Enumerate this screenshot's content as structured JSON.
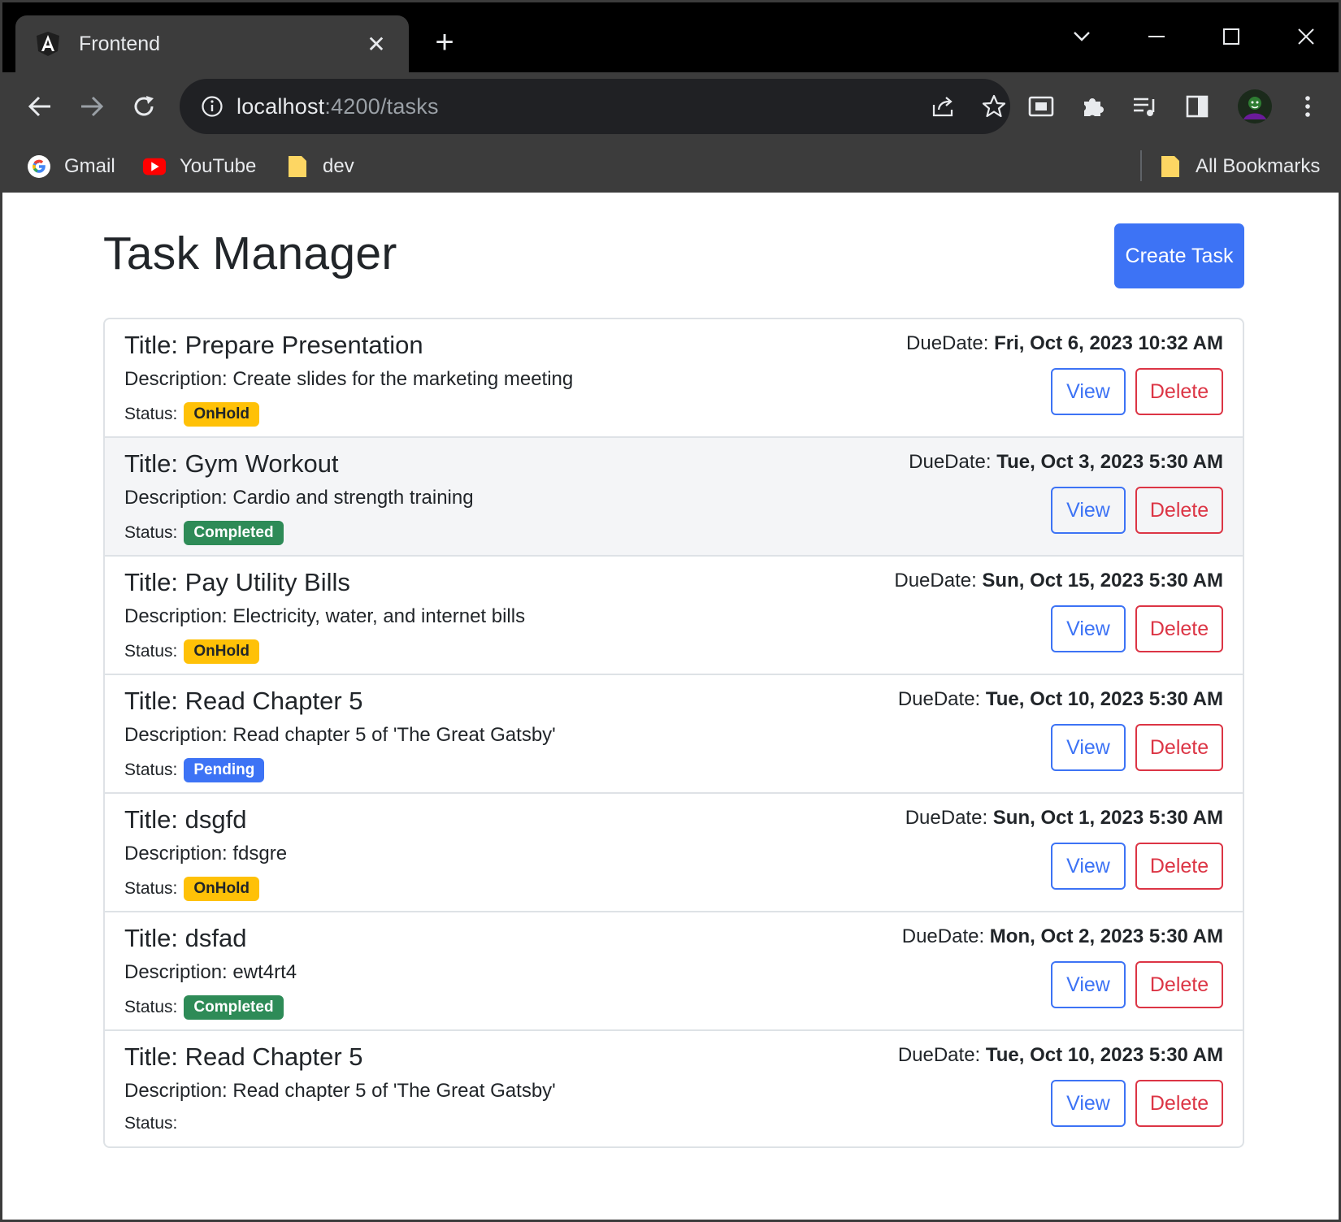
{
  "browser": {
    "tab_title": "Frontend",
    "url_host": "localhost",
    "url_path": ":4200/tasks",
    "bookmarks": [
      {
        "label": "Gmail",
        "icon": "google-icon"
      },
      {
        "label": "YouTube",
        "icon": "youtube-icon"
      },
      {
        "label": "dev",
        "icon": "folder-icon"
      }
    ],
    "all_bookmarks_label": "All Bookmarks"
  },
  "page": {
    "title": "Task Manager",
    "create_label": "Create Task",
    "view_label": "View",
    "delete_label": "Delete"
  },
  "tasks": [
    {
      "title": "Title: Prepare Presentation",
      "description": "Description: Create slides for the marketing meeting",
      "status_label": "Status:",
      "status": "OnHold",
      "due_label": "DueDate:",
      "due": "Fri, Oct 6, 2023 10:32 AM"
    },
    {
      "title": "Title: Gym Workout",
      "description": "Description: Cardio and strength training",
      "status_label": "Status:",
      "status": "Completed",
      "due_label": "DueDate:",
      "due": "Tue, Oct 3, 2023 5:30 AM"
    },
    {
      "title": "Title: Pay Utility Bills",
      "description": "Description: Electricity, water, and internet bills",
      "status_label": "Status:",
      "status": "OnHold",
      "due_label": "DueDate:",
      "due": "Sun, Oct 15, 2023 5:30 AM"
    },
    {
      "title": "Title: Read Chapter 5",
      "description": "Description: Read chapter 5 of 'The Great Gatsby'",
      "status_label": "Status:",
      "status": "Pending",
      "due_label": "DueDate:",
      "due": "Tue, Oct 10, 2023 5:30 AM"
    },
    {
      "title": "Title: dsgfd",
      "description": "Description: fdsgre",
      "status_label": "Status:",
      "status": "OnHold",
      "due_label": "DueDate:",
      "due": "Sun, Oct 1, 2023 5:30 AM"
    },
    {
      "title": "Title: dsfad",
      "description": "Description: ewt4rt4",
      "status_label": "Status:",
      "status": "Completed",
      "due_label": "DueDate:",
      "due": "Mon, Oct 2, 2023 5:30 AM"
    },
    {
      "title": "Title: Read Chapter 5",
      "description": "Description: Read chapter 5 of 'The Great Gatsby'",
      "status_label": "Status:",
      "status": "",
      "due_label": "DueDate:",
      "due": "Tue, Oct 10, 2023 5:30 AM"
    }
  ],
  "colors": {
    "primary": "#3d73f5",
    "danger": "#dc3545",
    "warning": "#ffc107",
    "success": "#2e8b57"
  }
}
